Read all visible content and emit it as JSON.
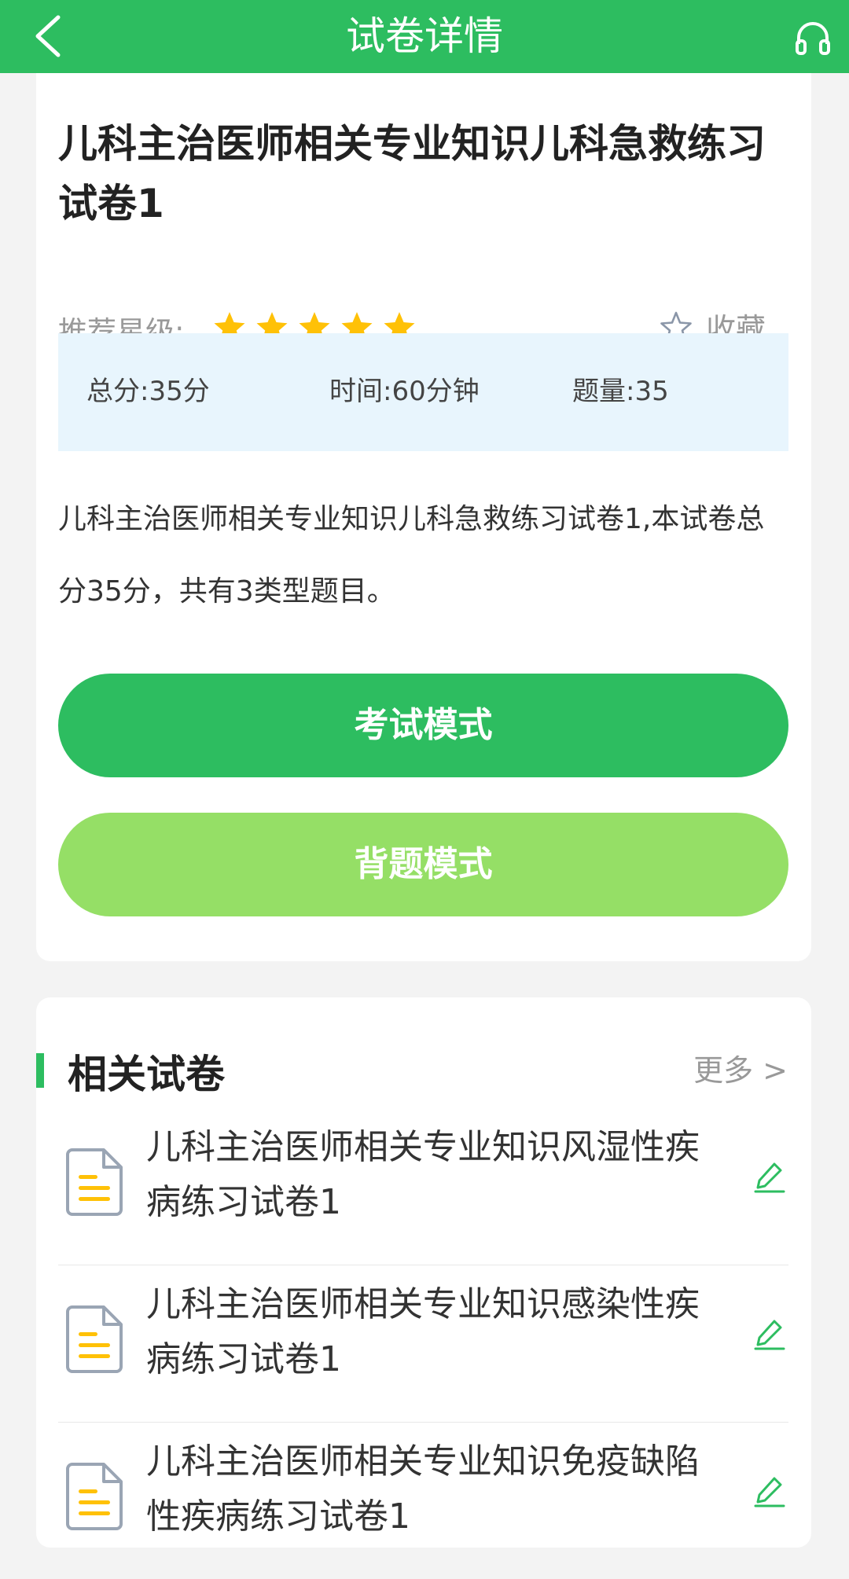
{
  "header": {
    "title": "试卷详情"
  },
  "paper": {
    "title": "儿科主治医师相关专业知识儿科急救练习试卷1",
    "rating_label": "推荐星级:",
    "stars": 5,
    "favorite_label": "收藏",
    "stats": {
      "total_score": "总分:35分",
      "time": "时间:60分钟",
      "count": "题量:35"
    },
    "description": "儿科主治医师相关专业知识儿科急救练习试卷1,本试卷总分35分，共有3类型题目。",
    "exam_button": "考试模式",
    "recite_button": "背题模式"
  },
  "related": {
    "title": "相关试卷",
    "more": "更多 >",
    "items": [
      {
        "label": "儿科主治医师相关专业知识风湿性疾病练习试卷1"
      },
      {
        "label": "儿科主治医师相关专业知识感染性疾病练习试卷1"
      },
      {
        "label": "儿科主治医师相关专业知识免疫缺陷性疾病练习试卷1"
      }
    ]
  },
  "colors": {
    "primary_green": "#2dbd60",
    "light_green": "#95df66",
    "star_yellow": "#ffc107",
    "stats_bg": "#e8f5fd"
  }
}
